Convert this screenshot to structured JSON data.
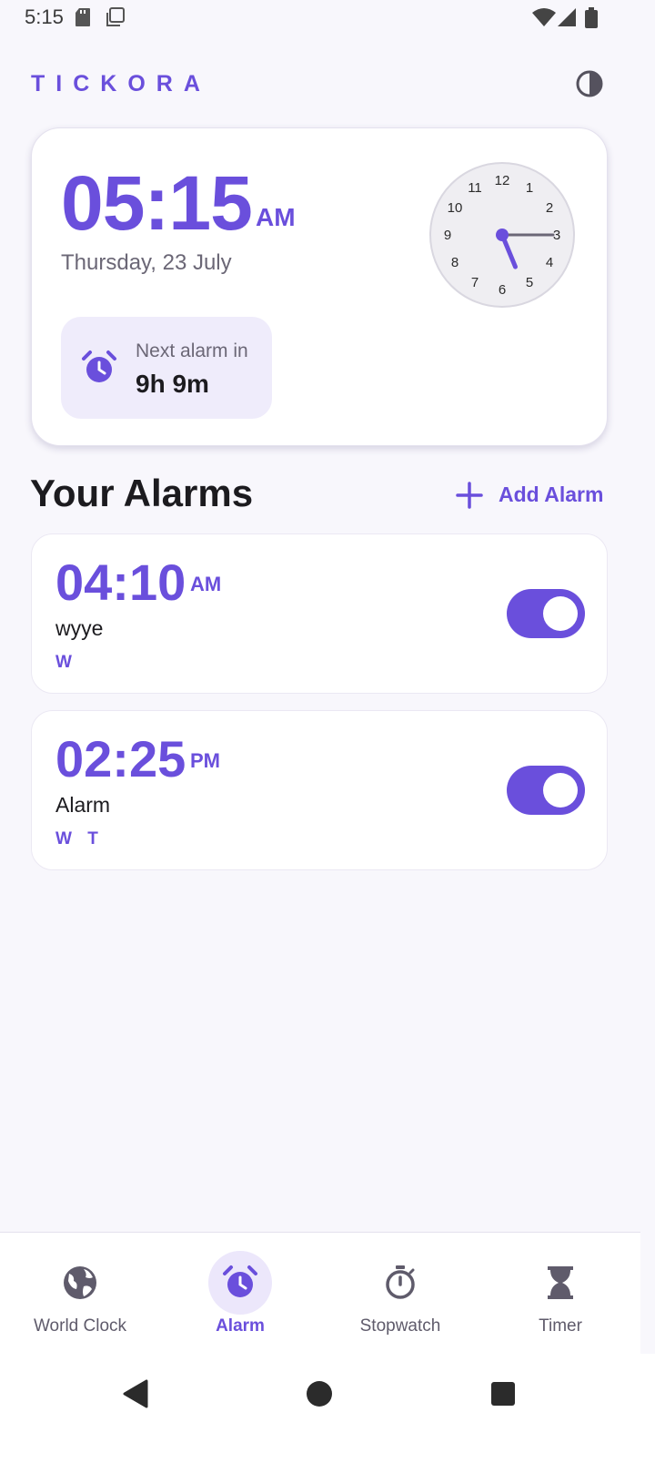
{
  "status_bar": {
    "time": "5:15",
    "icons": [
      "sd-card-icon",
      "screenshot-icon",
      "wifi-icon",
      "signal-icon",
      "battery-icon"
    ]
  },
  "header": {
    "brand": "TICKORA",
    "theme_icon": "contrast-icon"
  },
  "clock_card": {
    "time": "05:15",
    "ampm": "AM",
    "date": "Thursday, 23 July",
    "analog_clock": {
      "numbers": [
        "12",
        "1",
        "2",
        "3",
        "4",
        "5",
        "6",
        "7",
        "8",
        "9",
        "10",
        "11"
      ],
      "hour": 5,
      "minute": 15
    },
    "next_alarm": {
      "icon": "alarm-clock-icon",
      "label": "Next alarm in",
      "value": "9h 9m"
    }
  },
  "alarms_section": {
    "title": "Your Alarms",
    "add_label": "Add Alarm"
  },
  "alarms": [
    {
      "time": "04:10",
      "ampm": "AM",
      "label": "wyye",
      "days": [
        "W"
      ],
      "enabled": true
    },
    {
      "time": "02:25",
      "ampm": "PM",
      "label": "Alarm",
      "days": [
        "W",
        "T"
      ],
      "enabled": true
    }
  ],
  "bottom_nav": {
    "items": [
      {
        "label": "World Clock",
        "icon": "globe-icon",
        "active": false
      },
      {
        "label": "Alarm",
        "icon": "alarm-clock-icon",
        "active": true
      },
      {
        "label": "Stopwatch",
        "icon": "stopwatch-icon",
        "active": false
      },
      {
        "label": "Timer",
        "icon": "hourglass-icon",
        "active": false
      }
    ]
  },
  "system_nav": {
    "buttons": [
      "back-icon",
      "home-icon",
      "recents-icon"
    ]
  },
  "colors": {
    "accent": "#6a4fdc",
    "background": "#f8f7fc",
    "chip_background": "#efecfb"
  }
}
